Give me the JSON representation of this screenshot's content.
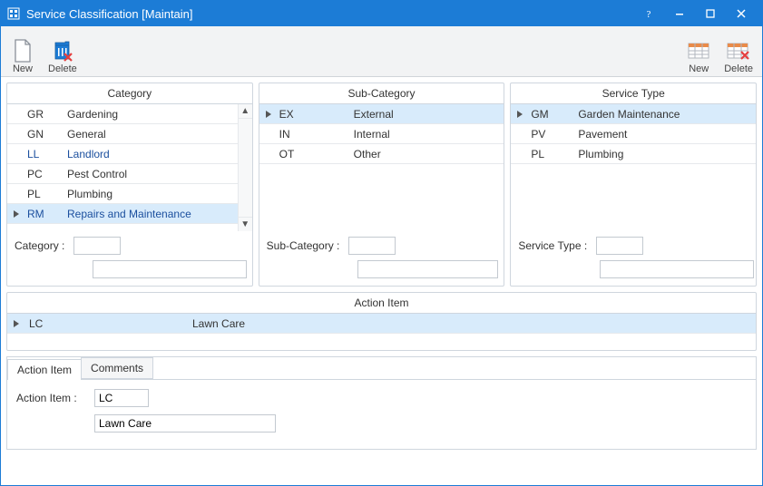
{
  "window": {
    "title": "Service Classification [Maintain]"
  },
  "toolbar": {
    "left": {
      "new": "New",
      "delete": "Delete"
    },
    "right": {
      "new": "New",
      "delete": "Delete"
    }
  },
  "panels": {
    "category": {
      "header": "Category",
      "label": "Category :",
      "rows": [
        {
          "code": "GR",
          "desc": "Gardening"
        },
        {
          "code": "GN",
          "desc": "General"
        },
        {
          "code": "LL",
          "desc": "Landlord"
        },
        {
          "code": "PC",
          "desc": "Pest Control"
        },
        {
          "code": "PL",
          "desc": "Plumbing"
        },
        {
          "code": "RM",
          "desc": "Repairs and Maintenance"
        }
      ],
      "selected_index": 5,
      "code_value": "",
      "desc_value": ""
    },
    "subcategory": {
      "header": "Sub-Category",
      "label": "Sub-Category :",
      "rows": [
        {
          "code": "EX",
          "desc": "External"
        },
        {
          "code": "IN",
          "desc": "Internal"
        },
        {
          "code": "OT",
          "desc": "Other"
        }
      ],
      "selected_index": 0,
      "code_value": "",
      "desc_value": ""
    },
    "servicetype": {
      "header": "Service Type",
      "label": "Service Type :",
      "rows": [
        {
          "code": "GM",
          "desc": "Garden Maintenance"
        },
        {
          "code": "PV",
          "desc": "Pavement"
        },
        {
          "code": "PL",
          "desc": "Plumbing"
        }
      ],
      "selected_index": 0,
      "code_value": "",
      "desc_value": ""
    }
  },
  "action_item": {
    "header": "Action Item",
    "rows": [
      {
        "code": "LC",
        "desc": "Lawn Care"
      }
    ],
    "selected_index": 0
  },
  "tabs": {
    "items": [
      {
        "label": "Action Item"
      },
      {
        "label": "Comments"
      }
    ],
    "active_index": 0,
    "action_item": {
      "label": "Action Item :",
      "code_value": "LC",
      "desc_value": "Lawn Care"
    }
  }
}
